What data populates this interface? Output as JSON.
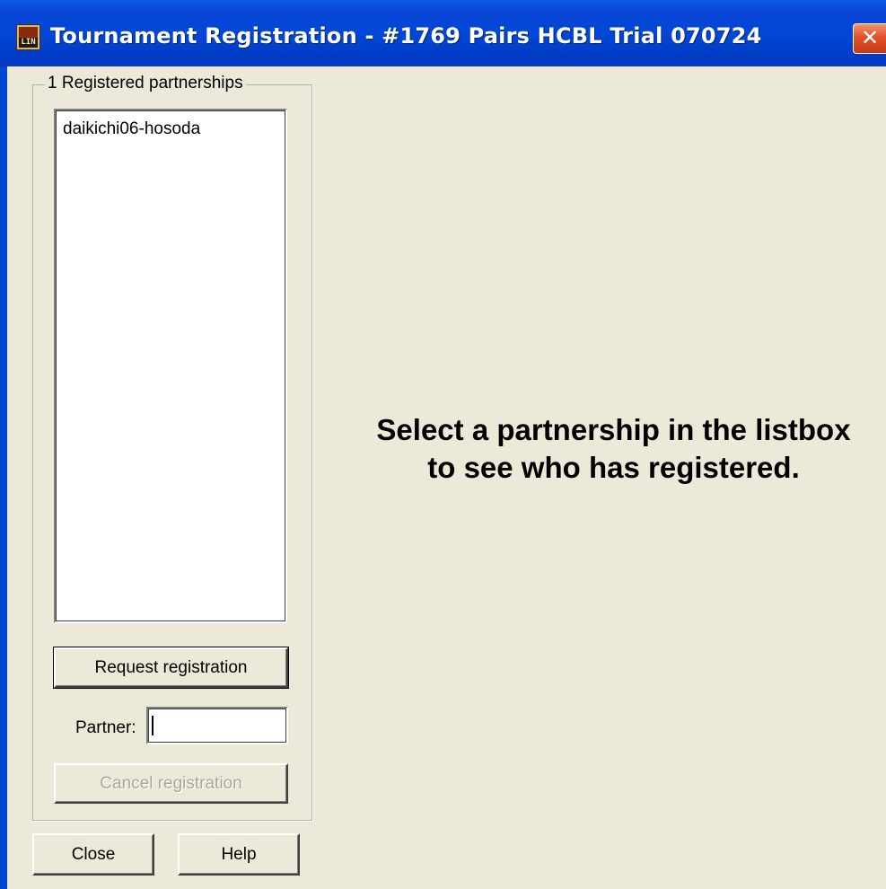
{
  "window": {
    "title": "Tournament Registration - #1769 Pairs HCBL Trial 070724",
    "close_glyph": "✕",
    "app_icon_text": "LIN"
  },
  "registered_group": {
    "legend": "1 Registered partnerships",
    "items": [
      "daikichi06-hosoda"
    ]
  },
  "buttons": {
    "request_registration": "Request registration",
    "cancel_registration": "Cancel registration",
    "close": "Close",
    "help": "Help"
  },
  "partner": {
    "label": "Partner:",
    "value": ""
  },
  "message": {
    "line1": "Select a partnership in the listbox",
    "line2": "to see who has registered."
  }
}
